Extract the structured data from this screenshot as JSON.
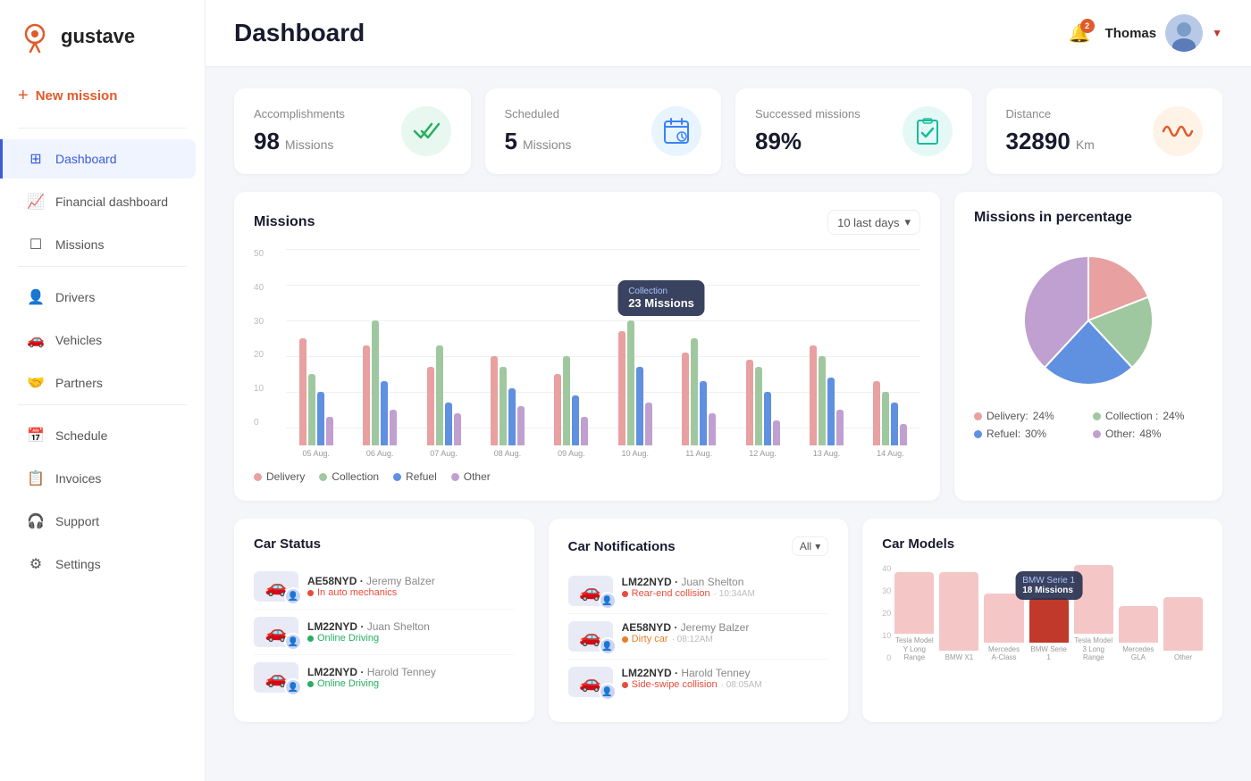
{
  "app": {
    "name": "gustave",
    "logo_icon": "📍"
  },
  "sidebar": {
    "new_mission_label": "New mission",
    "items": [
      {
        "id": "dashboard",
        "label": "Dashboard",
        "icon": "⊞",
        "active": true
      },
      {
        "id": "financial",
        "label": "Financial dashboard",
        "icon": "📈",
        "active": false
      },
      {
        "id": "missions",
        "label": "Missions",
        "icon": "☐",
        "active": false
      },
      {
        "id": "drivers",
        "label": "Drivers",
        "icon": "👤",
        "active": false
      },
      {
        "id": "vehicles",
        "label": "Vehicles",
        "icon": "🚗",
        "active": false
      },
      {
        "id": "partners",
        "label": "Partners",
        "icon": "🤝",
        "active": false
      },
      {
        "id": "schedule",
        "label": "Schedule",
        "icon": "📅",
        "active": false
      },
      {
        "id": "invoices",
        "label": "Invoices",
        "icon": "📋",
        "active": false
      },
      {
        "id": "support",
        "label": "Support",
        "icon": "🎧",
        "active": false
      },
      {
        "id": "settings",
        "label": "Settings",
        "icon": "⚙",
        "active": false
      }
    ]
  },
  "topbar": {
    "title": "Dashboard",
    "notif_count": "2",
    "user_name": "Thomas",
    "chevron": "▼"
  },
  "stats": [
    {
      "label": "Accomplishments",
      "value": "98",
      "unit": "Missions",
      "icon": "✓✓",
      "icon_class": "stat-icon-green"
    },
    {
      "label": "Scheduled",
      "value": "5",
      "unit": "Missions",
      "icon": "📅",
      "icon_class": "stat-icon-blue"
    },
    {
      "label": "Successed missions",
      "value": "89%",
      "unit": "",
      "icon": "✓☐",
      "icon_class": "stat-icon-teal"
    },
    {
      "label": "Distance",
      "value": "32890",
      "unit": "Km",
      "icon": "〜",
      "icon_class": "stat-icon-orange"
    }
  ],
  "missions_chart": {
    "title": "Missions",
    "filter": "10 last days",
    "y_labels": [
      "50",
      "40",
      "30",
      "20",
      "10",
      "0"
    ],
    "dates": [
      "05 Aug.",
      "06 Aug.",
      "07 Aug.",
      "08 Aug.",
      "09 Aug.",
      "10 Aug.",
      "11 Aug.",
      "12 Aug.",
      "13 Aug.",
      "14 Aug."
    ],
    "bars": [
      {
        "delivery": 30,
        "collection": 20,
        "refuel": 15,
        "other": 8
      },
      {
        "delivery": 28,
        "collection": 35,
        "refuel": 18,
        "other": 10
      },
      {
        "delivery": 22,
        "collection": 28,
        "refuel": 12,
        "other": 9
      },
      {
        "delivery": 25,
        "collection": 22,
        "refuel": 16,
        "other": 11
      },
      {
        "delivery": 20,
        "collection": 25,
        "refuel": 14,
        "other": 8
      },
      {
        "delivery": 32,
        "collection": 35,
        "refuel": 22,
        "other": 12
      },
      {
        "delivery": 26,
        "collection": 30,
        "refuel": 18,
        "other": 9
      },
      {
        "delivery": 24,
        "collection": 22,
        "refuel": 15,
        "other": 7
      },
      {
        "delivery": 28,
        "collection": 25,
        "refuel": 19,
        "other": 10
      },
      {
        "delivery": 18,
        "collection": 15,
        "refuel": 12,
        "other": 6
      }
    ],
    "tooltip": {
      "label": "Collection",
      "value": "23 Missions",
      "bar_index": 5
    },
    "legend": [
      {
        "label": "Delivery",
        "color": "#e8a0a0"
      },
      {
        "label": "Collection",
        "color": "#a0c8a0"
      },
      {
        "label": "Refuel",
        "color": "#6090e0"
      },
      {
        "label": "Other",
        "color": "#c0a0d0"
      }
    ]
  },
  "pie_chart": {
    "title": "Missions in percentage",
    "segments": [
      {
        "label": "Delivery",
        "pct": 24,
        "color": "#e8a0a0",
        "pct_label": "24%"
      },
      {
        "label": "Collection",
        "pct": 24,
        "color": "#a0c8a0",
        "pct_label": "24%"
      },
      {
        "label": "Refuel",
        "pct": 30,
        "color": "#6090e0",
        "pct_label": "30%"
      },
      {
        "label": "Other",
        "pct": 48,
        "color": "#c0a0d0",
        "pct_label": "48%"
      }
    ]
  },
  "car_status": {
    "title": "Car Status",
    "items": [
      {
        "plate": "AE58NYD",
        "person": "Jeremy Balzer",
        "status": "In auto mechanics",
        "status_class": "status-red"
      },
      {
        "plate": "LM22NYD",
        "person": "Juan Shelton",
        "status": "Online Driving",
        "status_class": "status-green"
      },
      {
        "plate": "LM22NYD",
        "person": "Harold Tenney",
        "status": "Online Driving",
        "status_class": "status-green"
      }
    ]
  },
  "car_notifications": {
    "title": "Car Notifications",
    "filter": "All",
    "items": [
      {
        "plate": "LM22NYD",
        "person": "Juan Shelton",
        "desc": "Rear-end collision",
        "time": "10:34AM",
        "dot": "dot-red"
      },
      {
        "plate": "AE58NYD",
        "person": "Jeremy Balzer",
        "desc": "Dirty car",
        "time": "08:12AM",
        "dot": "dot-orange"
      },
      {
        "plate": "LM22NYD",
        "person": "Harold Tenney",
        "desc": "Side-swipe collision",
        "time": "08:05AM",
        "dot": "dot-red"
      }
    ]
  },
  "car_models": {
    "title": "Car Models",
    "y_labels": [
      "40",
      "30",
      "20",
      "10",
      "0"
    ],
    "bars": [
      {
        "label": "Tesla Model Y Long Range",
        "value": 25,
        "active": false
      },
      {
        "label": "BMW X1",
        "value": 32,
        "active": false
      },
      {
        "label": "Mercedes A-Class",
        "value": 20,
        "active": false
      },
      {
        "label": "BMW Serie 1",
        "value": 18,
        "active": true,
        "tooltip": "BMW Serie 1\n18 Missions"
      },
      {
        "label": "Tesla Model 3 Long Range",
        "value": 28,
        "active": false
      },
      {
        "label": "Mercedes GLA",
        "value": 15,
        "active": false
      },
      {
        "label": "Other",
        "value": 22,
        "active": false
      }
    ],
    "max": 40
  }
}
